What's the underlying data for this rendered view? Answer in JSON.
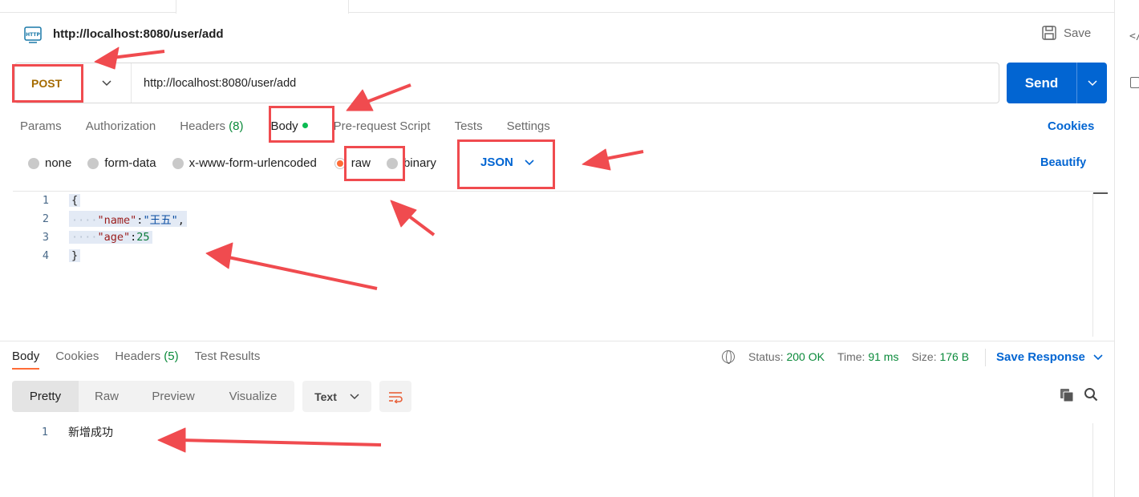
{
  "header": {
    "title": "http://localhost:8080/user/add",
    "http_icon_text": "HTTP",
    "save_label": "Save"
  },
  "request": {
    "method": "POST",
    "url": "http://localhost:8080/user/add",
    "send_label": "Send"
  },
  "request_tabs": {
    "params": "Params",
    "authorization": "Authorization",
    "headers": "Headers",
    "headers_count": "(8)",
    "body": "Body",
    "prerequest": "Pre-request Script",
    "tests": "Tests",
    "settings": "Settings",
    "cookies": "Cookies"
  },
  "body_options": {
    "none": "none",
    "form_data": "form-data",
    "urlencoded": "x-www-form-urlencoded",
    "raw": "raw",
    "binary": "binary",
    "selected": "raw",
    "format": "JSON",
    "beautify": "Beautify"
  },
  "editor": {
    "lines": [
      {
        "num": "1",
        "text": "{"
      },
      {
        "num": "2",
        "ws": "····",
        "key": "\"name\"",
        "colon": ":",
        "value": "\"王五\"",
        "tail": ","
      },
      {
        "num": "3",
        "ws": "····",
        "key": "\"age\"",
        "colon": ":",
        "value": "25",
        "tail": ""
      },
      {
        "num": "4",
        "text": "}"
      }
    ]
  },
  "response_tabs": {
    "body": "Body",
    "cookies": "Cookies",
    "headers": "Headers",
    "headers_count": "(5)",
    "test_results": "Test Results"
  },
  "response_stats": {
    "status_label": "Status:",
    "status_value": "200 OK",
    "time_label": "Time:",
    "time_value": "91 ms",
    "size_label": "Size:",
    "size_value": "176 B",
    "save_response": "Save Response"
  },
  "response_view": {
    "modes": [
      "Pretty",
      "Raw",
      "Preview",
      "Visualize"
    ],
    "active_mode": "Pretty",
    "format": "Text",
    "lines": [
      {
        "num": "1",
        "text": "新增成功"
      }
    ]
  },
  "rail": {
    "code_icon_text": "</"
  },
  "colors": {
    "accent_blue": "#0265d2",
    "method_color": "#a56b00",
    "success_green": "#0a8a3a",
    "annotation_red": "#f04b4f",
    "radio_active": "#ff6c37"
  }
}
